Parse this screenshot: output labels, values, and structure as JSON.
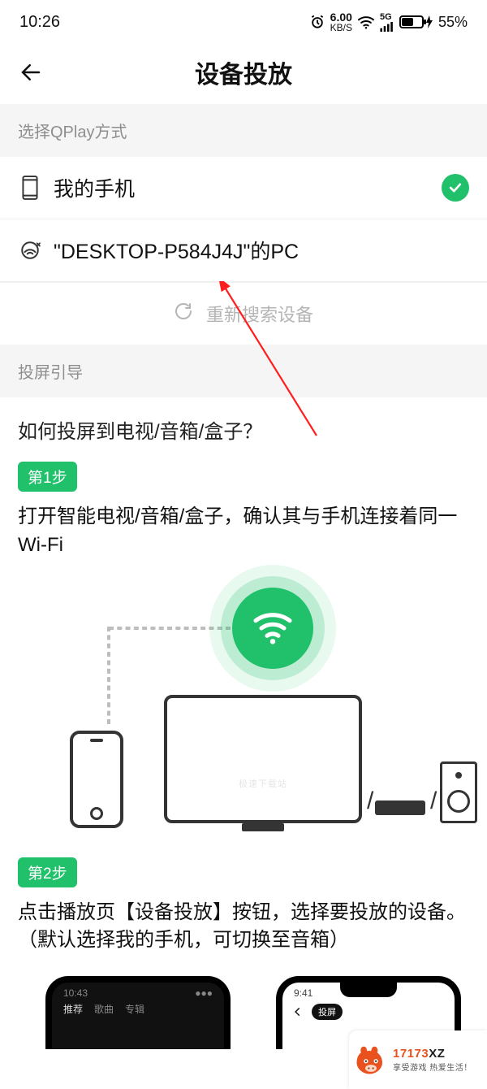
{
  "status": {
    "time": "10:26",
    "kbs_num": "6.00",
    "kbs_label": "KB/S",
    "net_label": "5G",
    "battery_pct": "55%"
  },
  "header": {
    "title": "设备投放"
  },
  "qplay": {
    "section_label": "选择QPlay方式",
    "devices": [
      {
        "name": "我的手机",
        "selected": true
      },
      {
        "name": "\"DESKTOP-P584J4J\"的PC",
        "selected": false
      }
    ],
    "rescan_label": "重新搜索设备"
  },
  "guide": {
    "section_label": "投屏引导",
    "question": "如何投屏到电视/音箱/盒子？",
    "steps": [
      {
        "badge": "第1步",
        "text": "打开智能电视/音箱/盒子，确认其与手机连接着同一Wi-Fi"
      },
      {
        "badge": "第2步",
        "text": "点击播放页【设备投放】按钮，选择要投放的设备。（默认选择我的手机，可切换至音箱）"
      }
    ]
  },
  "illustration": {
    "watermark": "极速下载站"
  },
  "preview": {
    "dark_time": "10:43",
    "dark_tabs": [
      "推荐",
      "歌曲",
      "专辑"
    ],
    "light_time": "9:41",
    "light_title": "投屏"
  },
  "watermark_badge": {
    "brand_prefix": "17173",
    "brand_suffix": "XZ",
    "tagline": "享受游戏  热爱生活！"
  }
}
